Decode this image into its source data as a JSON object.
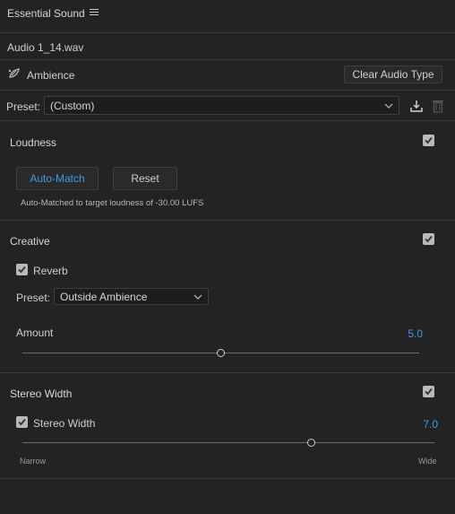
{
  "panel": {
    "title": "Essential Sound"
  },
  "clip": {
    "filename": "Audio 1_14.wav"
  },
  "type_row": {
    "label": "Ambience",
    "clear_button": "Clear Audio Type"
  },
  "preset_row": {
    "label": "Preset:",
    "value": "(Custom)"
  },
  "loudness": {
    "title": "Loudness",
    "auto_match_label": "Auto-Match",
    "reset_label": "Reset",
    "status_text": "Auto-Matched to target loudness of -30.00 LUFS",
    "enabled": true
  },
  "creative": {
    "title": "Creative",
    "enabled": true,
    "reverb_label": "Reverb",
    "reverb_checked": true,
    "preset_label": "Preset:",
    "preset_value": "Outside Ambience",
    "amount_label": "Amount",
    "amount_value": "5.0",
    "amount_fraction": 0.5
  },
  "stereo": {
    "title": "Stereo Width",
    "enabled": true,
    "width_label": "Stereo Width",
    "width_checked": true,
    "width_value": "7.0",
    "width_fraction": 0.7,
    "min_label": "Narrow",
    "max_label": "Wide"
  },
  "colors": {
    "accent": "#3e9ae8",
    "background": "#232323"
  },
  "icons": [
    "menu-icon",
    "ambience-icon",
    "chevron-down-icon",
    "save-preset-icon",
    "delete-preset-icon",
    "checkmark-icon"
  ]
}
